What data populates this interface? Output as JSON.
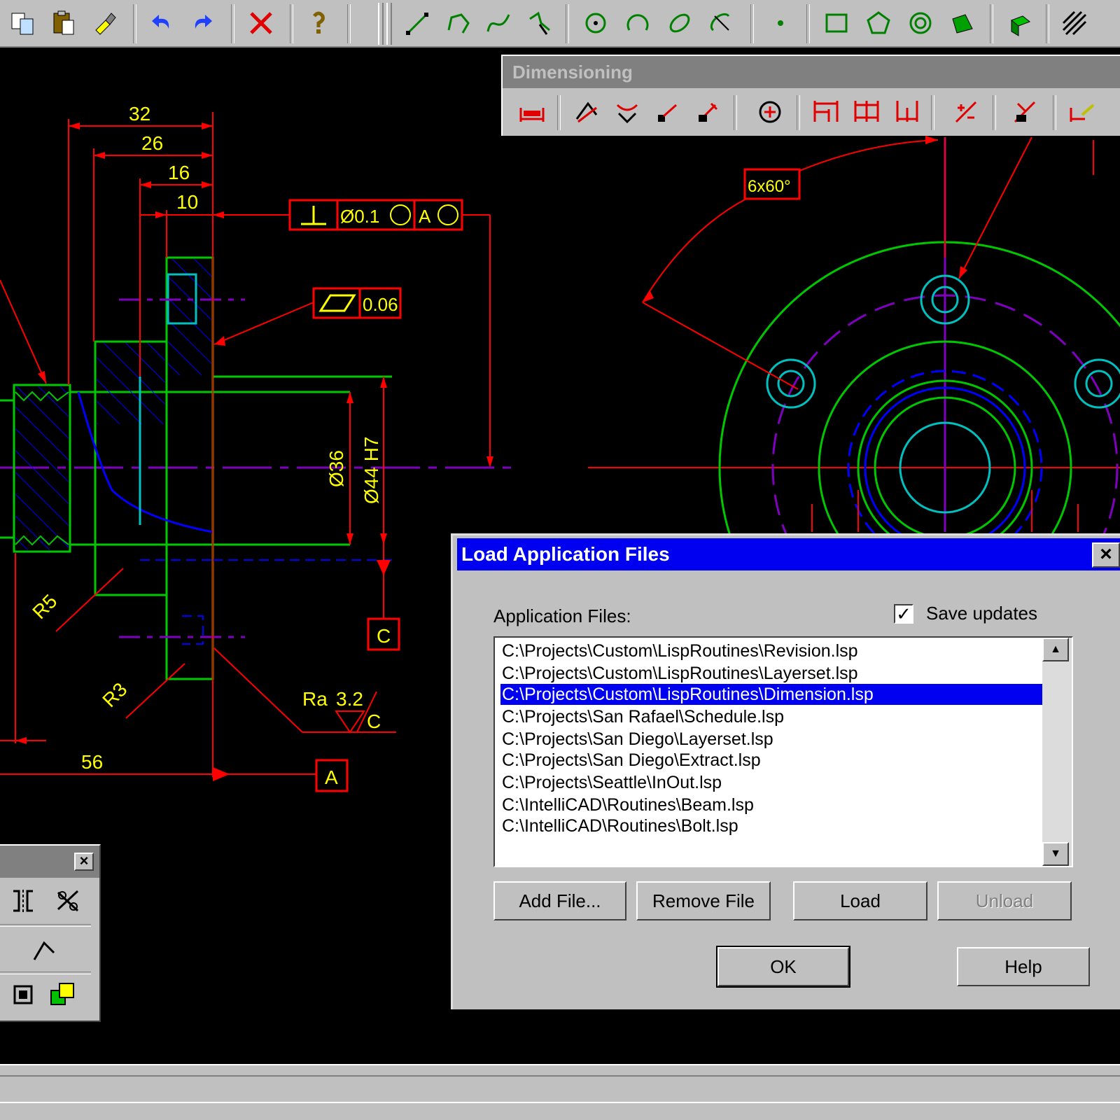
{
  "colors": {
    "drawing_bg": "#000000",
    "geometry_green": "#00c800",
    "dimension_red": "#ff0000",
    "text_yellow": "#ffff00",
    "hatch_blue": "#0000ff",
    "centerline_purple": "#8000c0",
    "cyan": "#00c0c0",
    "selection_blue": "#0000f0"
  },
  "toolbar": {
    "buttons": [
      {
        "name": "copy-icon"
      },
      {
        "name": "paste-icon"
      },
      {
        "name": "match-properties-icon"
      },
      {
        "name": "undo-icon"
      },
      {
        "name": "redo-icon"
      },
      {
        "name": "delete-icon"
      },
      {
        "name": "help-icon"
      },
      {
        "name": "line-icon"
      },
      {
        "name": "polyline-icon"
      },
      {
        "name": "spline-icon"
      },
      {
        "name": "freehand-icon"
      },
      {
        "name": "circle-icon"
      },
      {
        "name": "arc-icon"
      },
      {
        "name": "ellipse-icon"
      },
      {
        "name": "ellipse-arc-icon"
      },
      {
        "name": "point-icon"
      },
      {
        "name": "rectangle-icon"
      },
      {
        "name": "polygon-icon"
      },
      {
        "name": "donut-icon"
      },
      {
        "name": "solid-icon"
      },
      {
        "name": "3d-face-icon"
      },
      {
        "name": "hatch-icon"
      }
    ]
  },
  "dimensioning_toolbar": {
    "title": "Dimensioning",
    "buttons": [
      {
        "name": "linear-dimension-icon"
      },
      {
        "name": "aligned-dimension-icon"
      },
      {
        "name": "angular-dimension-icon"
      },
      {
        "name": "ordinate-dimension-icon"
      },
      {
        "name": "radius-dimension-icon"
      },
      {
        "name": "center-mark-icon"
      },
      {
        "name": "baseline-dimension-icon"
      },
      {
        "name": "continue-dimension-icon"
      },
      {
        "name": "dimension-chain-icon"
      },
      {
        "name": "tolerance-icon"
      },
      {
        "name": "dimension-edit-icon"
      },
      {
        "name": "dimension-text-icon"
      }
    ]
  },
  "drawing": {
    "dims": {
      "d32": "32",
      "d26": "26",
      "d16": "16",
      "d10": "10",
      "d56": "56",
      "dia36": "Ø36",
      "dia44": "Ø44 H7",
      "r5": "R5",
      "r3": "R3",
      "ra_label": "Ra",
      "ra_value": "3.2",
      "ra_suffix": "C",
      "holes": "6x60°",
      "datum_a": "A",
      "datum_c": "C"
    },
    "tolerance_frames": {
      "perp_value": "Ø0.1",
      "perp_datum": "A",
      "flat_value": "0.06"
    }
  },
  "dialog": {
    "title": "Load Application Files",
    "files_label": "Application Files:",
    "save_updates_label": "Save updates",
    "save_updates_checked": true,
    "files": [
      "C:\\Projects\\Custom\\LispRoutines\\Revision.lsp",
      "C:\\Projects\\Custom\\LispRoutines\\Layerset.lsp",
      "C:\\Projects\\Custom\\LispRoutines\\Dimension.lsp",
      "C:\\Projects\\San Rafael\\Schedule.lsp",
      "C:\\Projects\\San Diego\\Layerset.lsp",
      "C:\\Projects\\San Diego\\Extract.lsp",
      "C:\\Projects\\Seattle\\InOut.lsp",
      "C:\\IntelliCAD\\Routines\\Beam.lsp",
      "C:\\IntelliCAD\\Routines\\Bolt.lsp"
    ],
    "selected_index": 2,
    "buttons": {
      "add": "Add File...",
      "remove": "Remove File",
      "load": "Load",
      "unload": "Unload",
      "ok": "OK",
      "help": "Help"
    },
    "unload_enabled": false
  },
  "small_toolbar": {
    "buttons": [
      {
        "name": "mirror-icon"
      },
      {
        "name": "trim-icon"
      },
      {
        "name": "chamfer-icon"
      },
      {
        "name": "region-icon"
      },
      {
        "name": "boolean-icon"
      }
    ]
  }
}
